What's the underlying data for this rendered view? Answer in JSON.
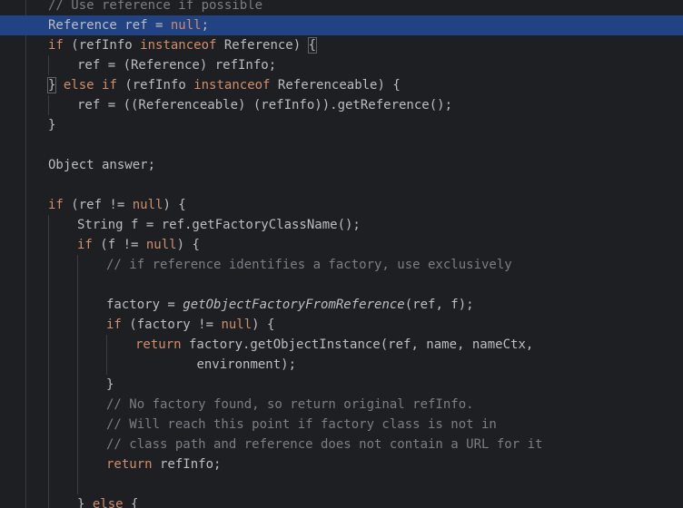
{
  "editor": {
    "language": "java",
    "lines": [
      {
        "indent": 0,
        "tokens": [
          {
            "t": "// Use reference if possible",
            "c": "cm"
          }
        ]
      },
      {
        "indent": 0,
        "highlight": true,
        "tokens": [
          {
            "t": "Reference ref = ",
            "c": "tx"
          },
          {
            "t": "null",
            "c": "kw"
          },
          {
            "t": ";",
            "c": "tx"
          }
        ]
      },
      {
        "indent": 0,
        "tokens": [
          {
            "t": "if",
            "c": "kw"
          },
          {
            "t": " (refInfo ",
            "c": "tx"
          },
          {
            "t": "instanceof",
            "c": "kw"
          },
          {
            "t": " Reference) ",
            "c": "tx"
          },
          {
            "t": "{",
            "c": "caret-brace"
          }
        ]
      },
      {
        "indent": 1,
        "tokens": [
          {
            "t": "ref = (Reference) refInfo;",
            "c": "tx"
          }
        ]
      },
      {
        "indent": 0,
        "tokens": [
          {
            "t": "}",
            "c": "caret-brace"
          },
          {
            "t": " ",
            "c": "tx"
          },
          {
            "t": "else if",
            "c": "kw"
          },
          {
            "t": " (refInfo ",
            "c": "tx"
          },
          {
            "t": "instanceof",
            "c": "kw"
          },
          {
            "t": " Referenceable) {",
            "c": "tx"
          }
        ]
      },
      {
        "indent": 1,
        "tokens": [
          {
            "t": "ref = ((Referenceable) (refInfo)).getReference();",
            "c": "tx"
          }
        ]
      },
      {
        "indent": 0,
        "tokens": [
          {
            "t": "}",
            "c": "tx"
          }
        ]
      },
      {
        "indent": 0,
        "tokens": []
      },
      {
        "indent": 0,
        "tokens": [
          {
            "t": "Object answer;",
            "c": "tx"
          }
        ]
      },
      {
        "indent": 0,
        "tokens": []
      },
      {
        "indent": 0,
        "tokens": [
          {
            "t": "if",
            "c": "kw"
          },
          {
            "t": " (ref != ",
            "c": "tx"
          },
          {
            "t": "null",
            "c": "kw"
          },
          {
            "t": ") {",
            "c": "tx"
          }
        ]
      },
      {
        "indent": 1,
        "tokens": [
          {
            "t": "String f = ref.getFactoryClassName();",
            "c": "tx"
          }
        ]
      },
      {
        "indent": 1,
        "tokens": [
          {
            "t": "if",
            "c": "kw"
          },
          {
            "t": " (f != ",
            "c": "tx"
          },
          {
            "t": "null",
            "c": "kw"
          },
          {
            "t": ") {",
            "c": "tx"
          }
        ]
      },
      {
        "indent": 2,
        "tokens": [
          {
            "t": "// if reference identifies a factory, use exclusively",
            "c": "cm"
          }
        ]
      },
      {
        "indent": 2,
        "tokens": []
      },
      {
        "indent": 2,
        "tokens": [
          {
            "t": "factory = ",
            "c": "tx"
          },
          {
            "t": "getObjectFactoryFromReference",
            "c": "fn"
          },
          {
            "t": "(ref, f);",
            "c": "tx"
          }
        ]
      },
      {
        "indent": 2,
        "tokens": [
          {
            "t": "if",
            "c": "kw"
          },
          {
            "t": " (factory != ",
            "c": "tx"
          },
          {
            "t": "null",
            "c": "kw"
          },
          {
            "t": ") {",
            "c": "tx"
          }
        ]
      },
      {
        "indent": 3,
        "tokens": [
          {
            "t": "return",
            "c": "kw"
          },
          {
            "t": " factory.getObjectInstance(ref, name, nameCtx,",
            "c": "tx"
          }
        ]
      },
      {
        "indent": 3,
        "extra": "        ",
        "tokens": [
          {
            "t": "environment);",
            "c": "tx"
          }
        ]
      },
      {
        "indent": 2,
        "tokens": [
          {
            "t": "}",
            "c": "tx"
          }
        ]
      },
      {
        "indent": 2,
        "tokens": [
          {
            "t": "// No factory found, so return original refInfo.",
            "c": "cm"
          }
        ]
      },
      {
        "indent": 2,
        "tokens": [
          {
            "t": "// Will reach this point if factory class is not in",
            "c": "cm"
          }
        ]
      },
      {
        "indent": 2,
        "tokens": [
          {
            "t": "// class path and reference does not contain a URL for it",
            "c": "cm"
          }
        ]
      },
      {
        "indent": 2,
        "tokens": [
          {
            "t": "return",
            "c": "kw"
          },
          {
            "t": " refInfo;",
            "c": "tx"
          }
        ]
      },
      {
        "indent": 2,
        "tokens": []
      },
      {
        "indent": 1,
        "tokens": [
          {
            "t": "} ",
            "c": "tx"
          },
          {
            "t": "else",
            "c": "kw"
          },
          {
            "t": " {",
            "c": "tx"
          }
        ]
      }
    ],
    "colors": {
      "background": "#1e1f22",
      "keyword": "#cf8e6d",
      "comment": "#7a7e85",
      "text": "#bcbec4",
      "highlight": "#214283"
    }
  }
}
